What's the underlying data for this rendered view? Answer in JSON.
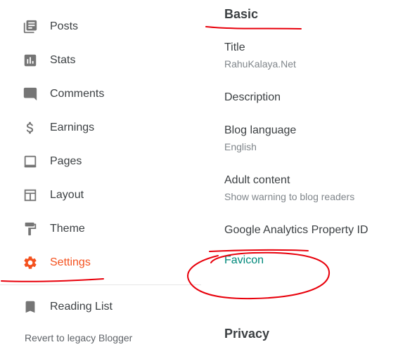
{
  "sidebar": {
    "items": [
      {
        "label": "Posts",
        "icon": "posts-icon"
      },
      {
        "label": "Stats",
        "icon": "stats-icon"
      },
      {
        "label": "Comments",
        "icon": "comments-icon"
      },
      {
        "label": "Earnings",
        "icon": "dollar-icon"
      },
      {
        "label": "Pages",
        "icon": "pages-icon"
      },
      {
        "label": "Layout",
        "icon": "layout-icon"
      },
      {
        "label": "Theme",
        "icon": "paint-roller-icon"
      },
      {
        "label": "Settings",
        "icon": "gear-icon",
        "active": true
      },
      {
        "label": "Reading List",
        "icon": "bookmark-icon"
      }
    ],
    "legacy_link": "Revert to legacy Blogger"
  },
  "main": {
    "basic_title": "Basic",
    "settings": [
      {
        "label": "Title",
        "value": "RahuKalaya.Net"
      },
      {
        "label": "Description",
        "value": ""
      },
      {
        "label": "Blog language",
        "value": "English"
      },
      {
        "label": "Adult content",
        "value": "Show warning to blog readers"
      },
      {
        "label": "Google Analytics Property ID",
        "value": ""
      },
      {
        "label": "Favicon",
        "value": ""
      }
    ],
    "privacy_title": "Privacy"
  },
  "colors": {
    "accent": "#f4511e",
    "link": "#00897b",
    "icon": "#757575",
    "annotation": "#e8000b"
  }
}
